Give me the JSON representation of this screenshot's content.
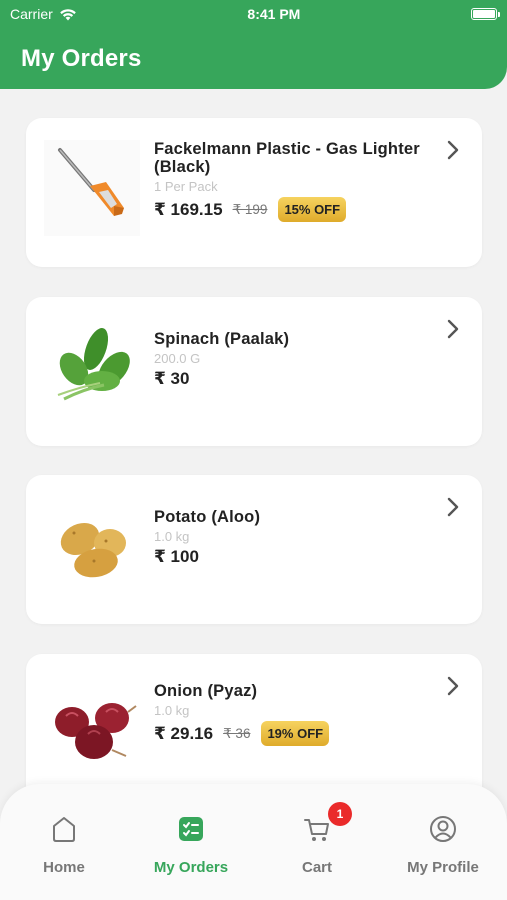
{
  "status_bar": {
    "carrier": "Carrier",
    "time": "8:41 PM"
  },
  "header": {
    "title": "My Orders"
  },
  "currency": "₹",
  "orders": [
    {
      "name": "Fackelmann Plastic - Gas Lighter (Black)",
      "qty": "1 Per Pack",
      "price": "₹ 169.15",
      "mrp": "₹ 199",
      "discount": "15% OFF",
      "image_icon": "gas-lighter-image"
    },
    {
      "name": "Spinach  (Paalak)",
      "qty": "200.0 G",
      "price": "₹ 30",
      "mrp": "",
      "discount": "",
      "image_icon": "spinach-image"
    },
    {
      "name": "Potato  (Aloo)",
      "qty": "1.0 kg",
      "price": "₹ 100",
      "mrp": "",
      "discount": "",
      "image_icon": "potato-image"
    },
    {
      "name": "Onion  (Pyaz)",
      "qty": "1.0 kg",
      "price": "₹ 29.16",
      "mrp": "₹ 36",
      "discount": "19% OFF",
      "image_icon": "onion-image"
    }
  ],
  "tabs": [
    {
      "label": "Home",
      "icon": "home-icon",
      "active": false
    },
    {
      "label": "My Orders",
      "icon": "orders-icon",
      "active": true
    },
    {
      "label": "Cart",
      "icon": "cart-icon",
      "active": false,
      "badge": "1"
    },
    {
      "label": "My Profile",
      "icon": "profile-icon",
      "active": false
    }
  ],
  "colors": {
    "brand_green": "#37a65b",
    "badge_red": "#ea2a2a",
    "discount_gold": "#e7b93c"
  }
}
